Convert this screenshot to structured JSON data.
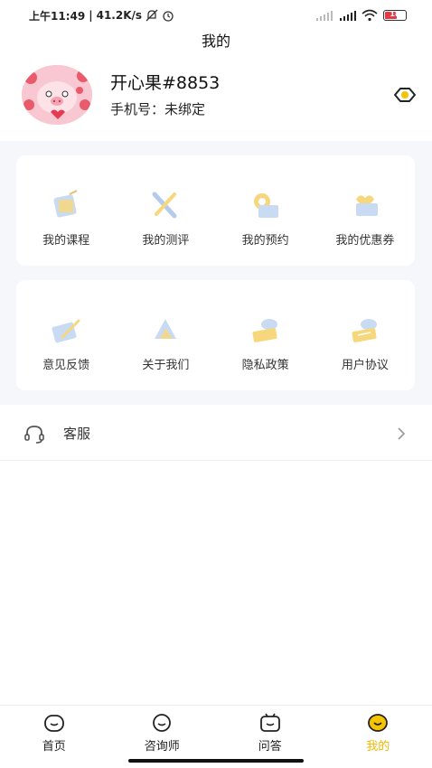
{
  "status_bar": {
    "time": "上午11:49",
    "net_speed": "41.2K/s",
    "battery": "18"
  },
  "page_title": "我的",
  "profile": {
    "name": "开心果#8853",
    "phone": "手机号：未绑定"
  },
  "menu_row_1": [
    {
      "label": "我的课程",
      "icon": "course-icon"
    },
    {
      "label": "我的测评",
      "icon": "assessment-icon"
    },
    {
      "label": "我的预约",
      "icon": "appointment-icon"
    },
    {
      "label": "我的优惠券",
      "icon": "coupon-icon"
    }
  ],
  "menu_row_2": [
    {
      "label": "意见反馈",
      "icon": "feedback-icon"
    },
    {
      "label": "关于我们",
      "icon": "about-icon"
    },
    {
      "label": "隐私政策",
      "icon": "privacy-icon"
    },
    {
      "label": "用户协议",
      "icon": "agreement-icon"
    }
  ],
  "service": {
    "label": "客服"
  },
  "tabs": [
    {
      "label": "首页",
      "icon": "home-tab-icon"
    },
    {
      "label": "咨询师",
      "icon": "counselor-tab-icon"
    },
    {
      "label": "问答",
      "icon": "qa-tab-icon"
    },
    {
      "label": "我的",
      "icon": "mine-tab-icon",
      "active": true
    }
  ],
  "colors": {
    "accent": "#f5b900",
    "background_gray": "#f5f7fb",
    "icon_blue": "#a9c4ea",
    "icon_yellow": "#f7d77b"
  }
}
